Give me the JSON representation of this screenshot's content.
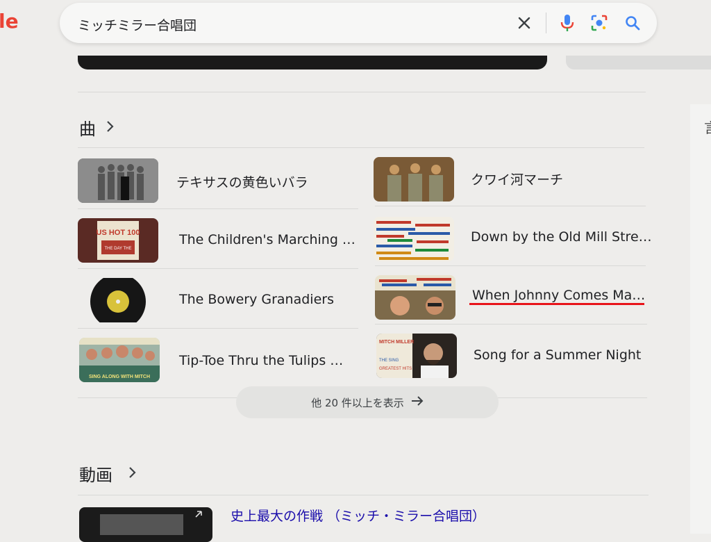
{
  "header": {
    "logo_fragment": "le",
    "search_query": "ミッチミラー合唱団"
  },
  "songs_section": {
    "title": "曲",
    "items": [
      {
        "title": "テキサスの黄色いバラ",
        "thumb_icon": "album-cover-group-photo"
      },
      {
        "title": "クワイ河マーチ",
        "thumb_icon": "album-cover-soldiers"
      },
      {
        "title": "The Children's Marching …",
        "thumb_icon": "album-cover-us-hot-100"
      },
      {
        "title": "Down by the Old Mill Stre…",
        "thumb_icon": "album-cover-song-list"
      },
      {
        "title": "The Bowery Granadiers",
        "thumb_icon": "vinyl-record"
      },
      {
        "title": "When Johnny Comes Ma…",
        "thumb_icon": "album-cover-singers"
      },
      {
        "title": "Tip-Toe Thru the Tulips …",
        "thumb_icon": "album-cover-sing-along"
      },
      {
        "title": "Song for a Summer Night",
        "thumb_icon": "album-cover-portrait"
      }
    ],
    "more_label": "他 20 件以上を表示"
  },
  "videos_section": {
    "title": "動画",
    "first_video_title": "史上最大の作戦 （ミッチ・ミラー合唱団）"
  },
  "colors": {
    "highlight_underline": "#e8141a",
    "video_link": "#1a0dab"
  }
}
